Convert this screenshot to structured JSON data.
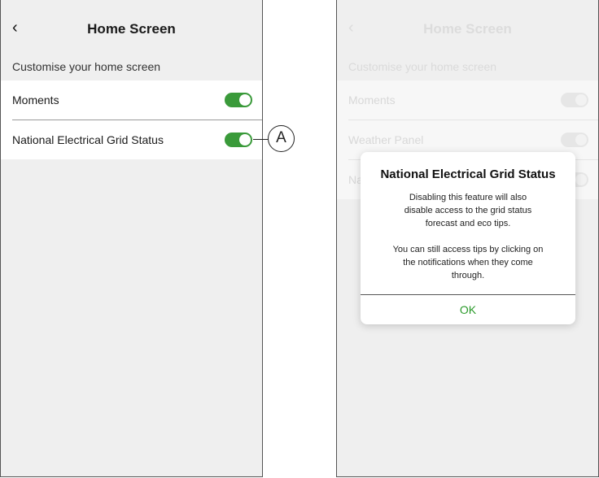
{
  "left_screen": {
    "back_icon": "chevron-left-icon",
    "back_glyph": "‹",
    "title": "Home Screen",
    "subtitle": "Customise your home screen",
    "items": [
      {
        "label": "Moments",
        "enabled": true
      },
      {
        "label": "National Electrical Grid Status",
        "enabled": true
      }
    ],
    "callout_label": "A"
  },
  "right_screen": {
    "back_glyph": "‹",
    "title": "Home Screen",
    "subtitle": "Customise your home screen",
    "items": [
      {
        "label": "Moments",
        "enabled": true
      },
      {
        "label": "Weather Panel",
        "enabled": true
      },
      {
        "label": "Na",
        "enabled": true
      }
    ]
  },
  "dialog": {
    "title": "National Electrical Grid Status",
    "body_line1": "Disabling this feature will also",
    "body_line2": "disable access to the grid status",
    "body_line3": "forecast and eco tips.",
    "body_line4": "You can still access tips by clicking on",
    "body_line5": "the notifications when they come",
    "body_line6": "through.",
    "ok_label": "OK"
  },
  "colors": {
    "toggle_on": "#3a9a3a",
    "ok_text": "#2a9a2a",
    "screen_bg": "#efefef"
  }
}
